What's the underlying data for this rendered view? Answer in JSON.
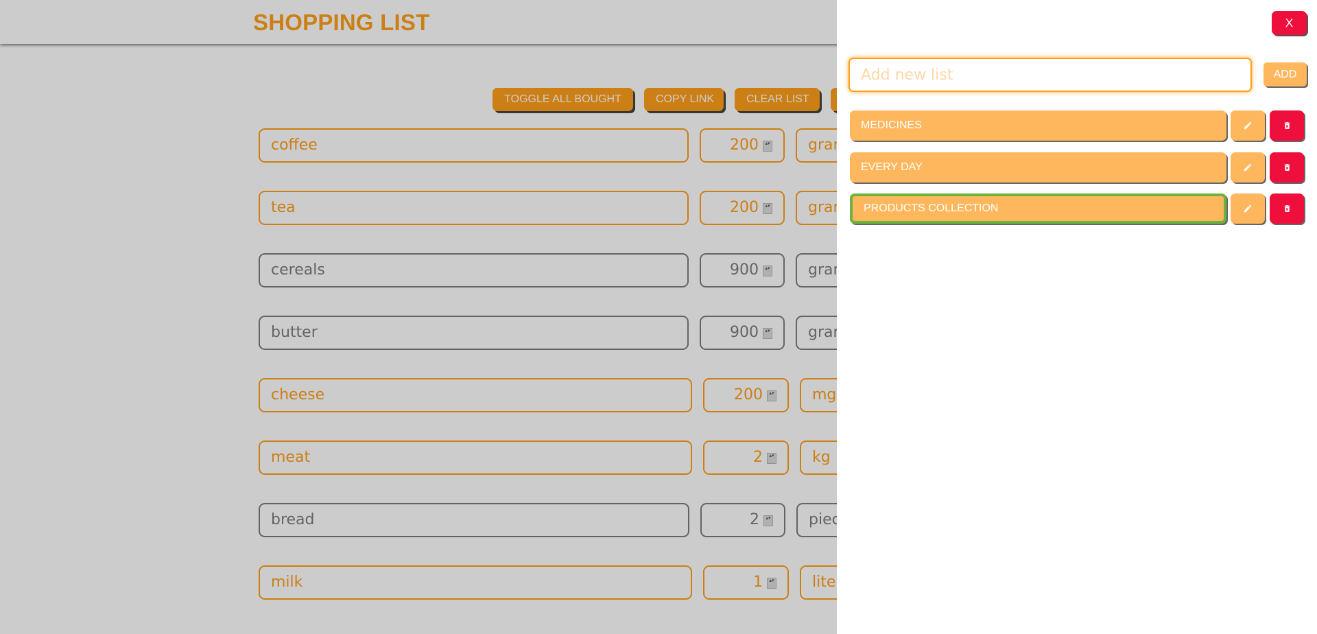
{
  "app": {
    "title": "SHOPPING LIST",
    "toolbar": {
      "toggle_all_label": "TOGGLE ALL BOUGHT",
      "copy_link_label": "COPY LINK",
      "clear_list_label": "CLEAR LIST"
    },
    "items": [
      {
        "name": "coffee",
        "quantity": "200",
        "unit": "gran",
        "bought": false
      },
      {
        "name": "tea",
        "quantity": "200",
        "unit": "gran",
        "bought": false
      },
      {
        "name": "cereals",
        "quantity": "900",
        "unit": "gran",
        "bought": true
      },
      {
        "name": "butter",
        "quantity": "900",
        "unit": "gran",
        "bought": true
      },
      {
        "name": "cheese",
        "quantity": "200",
        "unit": "mg",
        "bought": false
      },
      {
        "name": "meat",
        "quantity": "2",
        "unit": "kg",
        "bought": false
      },
      {
        "name": "bread",
        "quantity": "2",
        "unit": "piec",
        "bought": true
      },
      {
        "name": "milk",
        "quantity": "1",
        "unit": "lite",
        "bought": false
      }
    ]
  },
  "panel": {
    "close_label": "X",
    "new_list_placeholder": "Add new list",
    "add_label": "ADD",
    "lists": [
      {
        "label": "MEDICINES",
        "active": false
      },
      {
        "label": "EVERY DAY",
        "active": false
      },
      {
        "label": "PRODUCTS COLLECTION",
        "active": true
      }
    ]
  },
  "colors": {
    "accent": "#ff9f1a",
    "list_item": "#ffb75e",
    "danger": "#ee0f3c",
    "active_outline": "#6ab43e",
    "bought_gray": "#7d7d7d"
  },
  "icons": {
    "edit": "pencil-icon",
    "delete": "trash-icon"
  }
}
